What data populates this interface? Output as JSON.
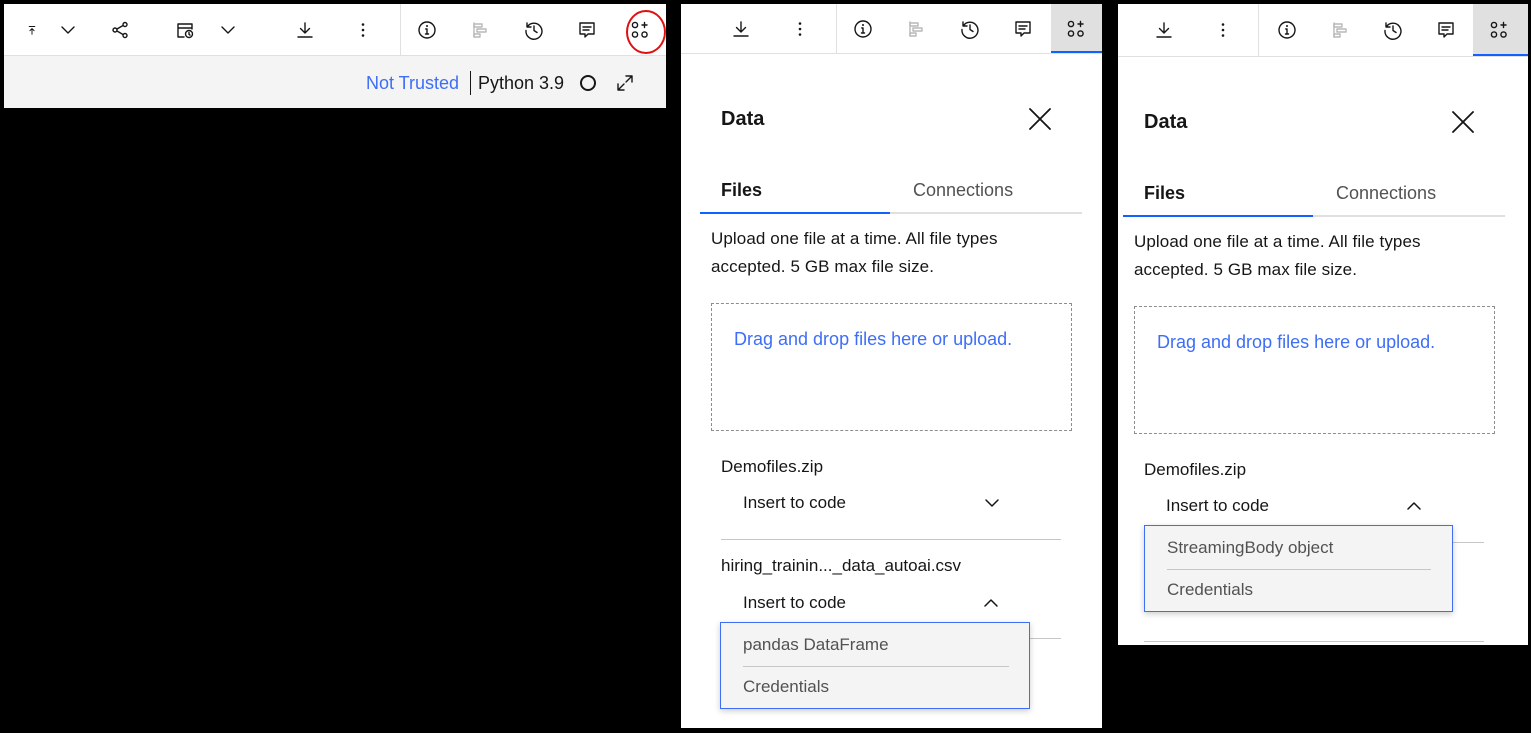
{
  "notebook_toolbar": {
    "status": {
      "trust_label": "Not Trusted",
      "kernel_label": "Python 3.9"
    },
    "icons": [
      "run-icon",
      "chevron-down-icon",
      "share-icon",
      "schedule-icon",
      "chevron-down-icon",
      "download-icon",
      "overflow-menu-icon",
      "information-icon",
      "outline-icon",
      "version-history-icon",
      "comments-icon",
      "find-and-add-data-icon",
      "expand-icon"
    ],
    "highlight_color": "#e01010"
  },
  "data_panel_1": {
    "title": "Data",
    "tabs": [
      "Files",
      "Connections"
    ],
    "description_line1": "Upload one file at a time. All file types",
    "description_line2": "accepted. 5 GB max file size.",
    "dropzone_text": "Drag and drop files here or upload.",
    "files": [
      {
        "name": "Demofiles.zip",
        "action": "Insert to code",
        "expanded": false
      },
      {
        "name": "hiring_trainin..._data_autoai.csv",
        "action": "Insert to code",
        "expanded": true
      }
    ],
    "menu_options": [
      "pandas DataFrame",
      "Credentials"
    ]
  },
  "data_panel_2": {
    "title": "Data",
    "tabs": [
      "Files",
      "Connections"
    ],
    "description_line1": "Upload one file at a time. All file types",
    "description_line2": "accepted. 5 GB max file size.",
    "dropzone_text": "Drag and drop files here or upload.",
    "files": [
      {
        "name": "Demofiles.zip",
        "action": "Insert to code",
        "expanded": true
      }
    ],
    "menu_options": [
      "StreamingBody object",
      "Credentials"
    ]
  },
  "colors": {
    "accent_blue": "#0f62fe",
    "link_blue": "#3e6ef6",
    "active_tool_bg": "#e0e0e0"
  }
}
